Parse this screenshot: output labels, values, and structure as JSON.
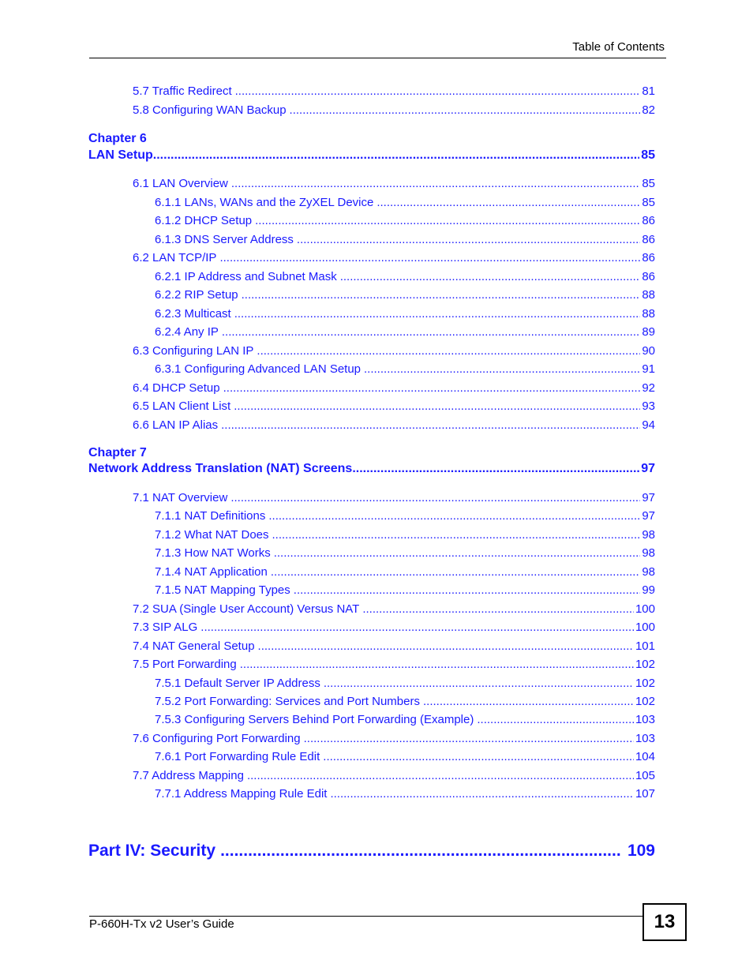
{
  "header": {
    "title": "Table of Contents"
  },
  "entries_before": [
    {
      "label": "5.7 Traffic Redirect",
      "page": "81"
    },
    {
      "label": "5.8 Configuring WAN Backup",
      "page": "82"
    }
  ],
  "chapter6": {
    "label": "Chapter  6",
    "title": "LAN Setup",
    "page": "85",
    "entries": [
      {
        "label": "6.1 LAN Overview",
        "page": "85",
        "level": 1
      },
      {
        "label": "6.1.1 LANs, WANs and the ZyXEL Device",
        "page": "85",
        "level": 2
      },
      {
        "label": "6.1.2 DHCP Setup",
        "page": "86",
        "level": 2
      },
      {
        "label": "6.1.3 DNS Server Address",
        "page": "86",
        "level": 2
      },
      {
        "label": "6.2 LAN TCP/IP",
        "page": "86",
        "level": 1
      },
      {
        "label": "6.2.1 IP Address and Subnet Mask",
        "page": "86",
        "level": 2
      },
      {
        "label": "6.2.2 RIP Setup",
        "page": "88",
        "level": 2
      },
      {
        "label": "6.2.3 Multicast",
        "page": "88",
        "level": 2
      },
      {
        "label": "6.2.4 Any IP",
        "page": "89",
        "level": 2
      },
      {
        "label": "6.3 Configuring LAN IP",
        "page": "90",
        "level": 1
      },
      {
        "label": "6.3.1 Configuring Advanced LAN Setup",
        "page": "91",
        "level": 2
      },
      {
        "label": "6.4 DHCP Setup",
        "page": "92",
        "level": 1
      },
      {
        "label": "6.5 LAN Client List",
        "page": "93",
        "level": 1
      },
      {
        "label": "6.6 LAN IP Alias",
        "page": "94",
        "level": 1
      }
    ]
  },
  "chapter7": {
    "label": "Chapter  7",
    "title": "Network Address Translation (NAT) Screens",
    "page": "97",
    "entries": [
      {
        "label": "7.1 NAT Overview",
        "page": "97",
        "level": 1
      },
      {
        "label": "7.1.1 NAT Definitions",
        "page": "97",
        "level": 2
      },
      {
        "label": "7.1.2 What NAT Does",
        "page": "98",
        "level": 2
      },
      {
        "label": "7.1.3 How NAT Works",
        "page": "98",
        "level": 2
      },
      {
        "label": "7.1.4 NAT Application",
        "page": "98",
        "level": 2
      },
      {
        "label": "7.1.5 NAT Mapping Types",
        "page": "99",
        "level": 2
      },
      {
        "label": "7.2 SUA (Single User Account) Versus NAT",
        "page": "100",
        "level": 1
      },
      {
        "label": "7.3 SIP ALG",
        "page": "100",
        "level": 1
      },
      {
        "label": "7.4 NAT General Setup",
        "page": "101",
        "level": 1
      },
      {
        "label": "7.5 Port Forwarding",
        "page": "102",
        "level": 1
      },
      {
        "label": "7.5.1 Default Server IP Address",
        "page": "102",
        "level": 2
      },
      {
        "label": "7.5.2 Port Forwarding: Services and Port Numbers",
        "page": "102",
        "level": 2
      },
      {
        "label": "7.5.3 Configuring Servers Behind Port Forwarding (Example)",
        "page": "103",
        "level": 2
      },
      {
        "label": "7.6 Configuring Port Forwarding",
        "page": "103",
        "level": 1
      },
      {
        "label": "7.6.1 Port Forwarding Rule Edit",
        "page": "104",
        "level": 2
      },
      {
        "label": "7.7 Address Mapping",
        "page": "105",
        "level": 1
      },
      {
        "label": "7.7.1 Address Mapping Rule Edit",
        "page": "107",
        "level": 2
      }
    ]
  },
  "part": {
    "title": "Part IV: Security",
    "page": "109"
  },
  "footer": {
    "guide_title": "P-660H-Tx v2 User’s Guide",
    "page_number": "13"
  },
  "colors": {
    "link": "#1a1aff",
    "text": "#000000"
  }
}
